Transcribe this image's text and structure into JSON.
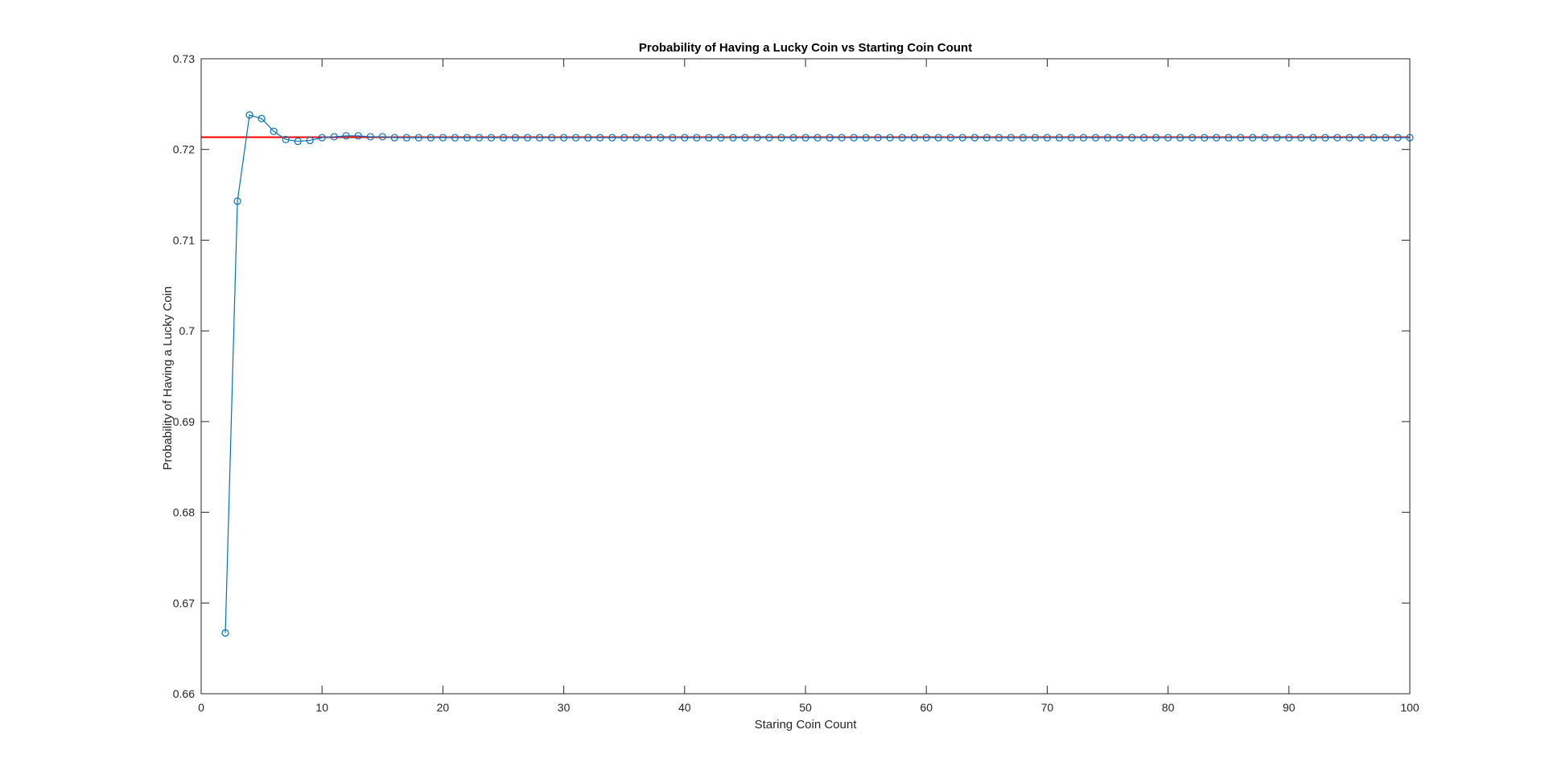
{
  "chart_data": {
    "type": "line",
    "title": "Probability of Having a Lucky Coin vs Starting Coin Count",
    "xlabel": "Staring Coin Count",
    "ylabel": "Probability of Having a Lucky Coin",
    "xlim": [
      0,
      100
    ],
    "ylim": [
      0.66,
      0.73
    ],
    "xticks": [
      0,
      10,
      20,
      30,
      40,
      50,
      60,
      70,
      80,
      90,
      100
    ],
    "xtick_labels": [
      "0",
      "10",
      "20",
      "30",
      "40",
      "50",
      "60",
      "70",
      "80",
      "90",
      "100"
    ],
    "yticks": [
      0.66,
      0.67,
      0.68,
      0.69,
      0.7,
      0.71,
      0.72,
      0.73
    ],
    "ytick_labels": [
      "0.66",
      "0.67",
      "0.68",
      "0.69",
      "0.7",
      "0.71",
      "0.72",
      "0.73"
    ],
    "grid": false,
    "series": [
      {
        "marker": "circle",
        "color": "#0072BD",
        "x": [
          2,
          3,
          4,
          5,
          6,
          7,
          8,
          9,
          10,
          11,
          12,
          13,
          14,
          15,
          16,
          17,
          18,
          19,
          20,
          21,
          22,
          23,
          24,
          25,
          26,
          27,
          28,
          29,
          30,
          31,
          32,
          33,
          34,
          35,
          36,
          37,
          38,
          39,
          40,
          41,
          42,
          43,
          44,
          45,
          46,
          47,
          48,
          49,
          50,
          51,
          52,
          53,
          54,
          55,
          56,
          57,
          58,
          59,
          60,
          61,
          62,
          63,
          64,
          65,
          66,
          67,
          68,
          69,
          70,
          71,
          72,
          73,
          74,
          75,
          76,
          77,
          78,
          79,
          80,
          81,
          82,
          83,
          84,
          85,
          86,
          87,
          88,
          89,
          90,
          91,
          92,
          93,
          94,
          95,
          96,
          97,
          98,
          99,
          100
        ],
        "y": [
          0.6667,
          0.7143,
          0.7238,
          0.7234,
          0.722,
          0.7211,
          0.7209,
          0.721,
          0.7213,
          0.7214,
          0.7215,
          0.7215,
          0.7214,
          0.7214,
          0.7213,
          0.7213,
          0.7213,
          0.7213,
          0.7213,
          0.7213,
          0.7213,
          0.7213,
          0.7213,
          0.7213,
          0.7213,
          0.7213,
          0.7213,
          0.7213,
          0.7213,
          0.7213,
          0.7213,
          0.7213,
          0.7213,
          0.7213,
          0.7213,
          0.7213,
          0.7213,
          0.7213,
          0.7213,
          0.7213,
          0.7213,
          0.7213,
          0.7213,
          0.7213,
          0.7213,
          0.7213,
          0.7213,
          0.7213,
          0.7213,
          0.7213,
          0.7213,
          0.7213,
          0.7213,
          0.7213,
          0.7213,
          0.7213,
          0.7213,
          0.7213,
          0.7213,
          0.7213,
          0.7213,
          0.7213,
          0.7213,
          0.7213,
          0.7213,
          0.7213,
          0.7213,
          0.7213,
          0.7213,
          0.7213,
          0.7213,
          0.7213,
          0.7213,
          0.7213,
          0.7213,
          0.7213,
          0.7213,
          0.7213,
          0.7213,
          0.7213,
          0.7213,
          0.7213,
          0.7213,
          0.7213,
          0.7213,
          0.7213,
          0.7213,
          0.7213,
          0.7213,
          0.7213,
          0.7213,
          0.7213,
          0.7213,
          0.7213,
          0.7213,
          0.7213,
          0.7213,
          0.7213,
          0.7213
        ]
      }
    ],
    "reference_line": {
      "y": 0.72135,
      "color": "#FF0000"
    }
  }
}
